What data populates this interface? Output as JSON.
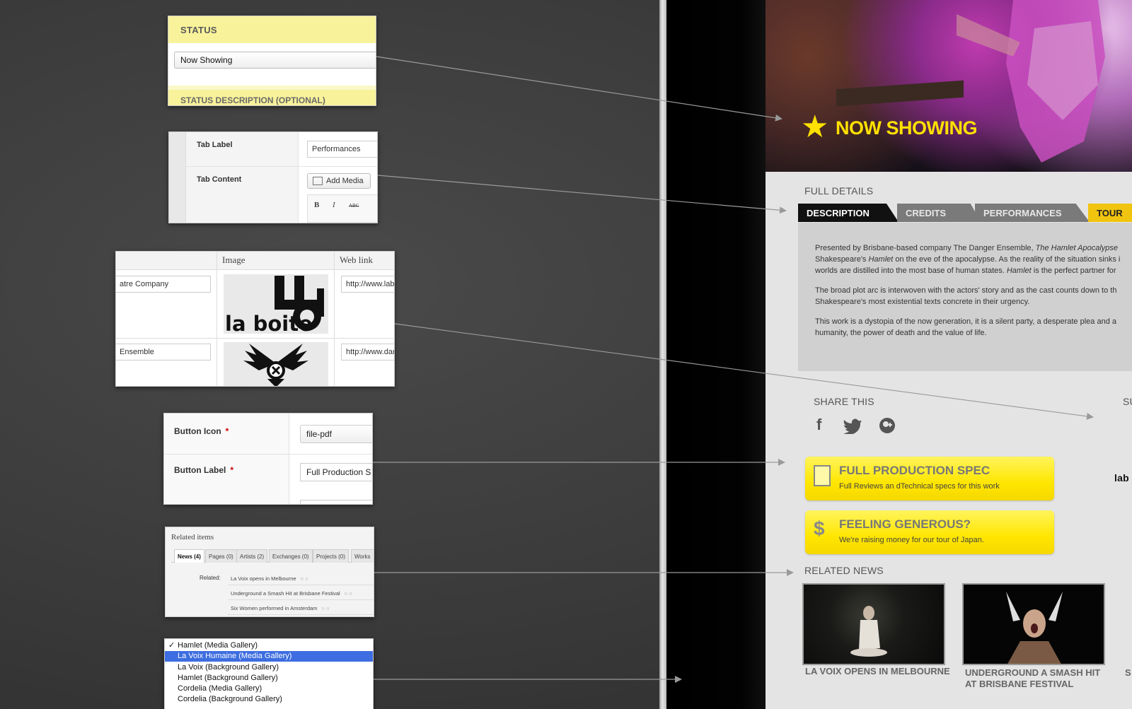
{
  "status_snippet": {
    "heading": "STATUS",
    "value": "Now Showing",
    "heading2": "STATUS DESCRIPTION (OPTIONAL)"
  },
  "tab_snippet": {
    "tab_label_label": "Tab Label",
    "tab_label_value": "Performances",
    "tab_content_label": "Tab Content",
    "add_media_label": "Add Media",
    "editor_bold": "B",
    "editor_italic": "I",
    "editor_strike": "ABC"
  },
  "logos_snippet": {
    "col_image": "Image",
    "col_weblink": "Web link",
    "rows": [
      {
        "name": "atre Company",
        "logo_text": "la boite",
        "link": "http://www.labo"
      },
      {
        "name": "Ensemble",
        "link": "http://www.dan"
      }
    ]
  },
  "button_snippet": {
    "icon_label": "Button Icon",
    "icon_value": "file-pdf",
    "label_label": "Button Label",
    "label_value": "Full Production S",
    "required": "*"
  },
  "related_snippet": {
    "title": "Related items",
    "tabs": [
      "News (4)",
      "Pages (0)",
      "Artists (2)",
      "Exchanges (0)",
      "Projects (0)",
      "Works"
    ],
    "related_label": "Related:",
    "items": [
      "La Voix opens in Melbourne",
      "Underground a Smash Hit at Brisbane Festival",
      "Six Women performed in Amsterdam"
    ]
  },
  "list_snippet": {
    "checkmark": "✓",
    "items": [
      "Hamlet (Media Gallery)",
      "La Voix Humaine (Media Gallery)",
      "La Voix (Background Gallery)",
      "Hamlet (Background Gallery)",
      "Cordelia (Media Gallery)",
      "Cordelia (Background Gallery)"
    ],
    "selected_index": 1
  },
  "page": {
    "hero_status": "NOW SHOWING",
    "full_details_title": "FULL DETAILS",
    "tabs": [
      "DESCRIPTION",
      "CREDITS",
      "PERFORMANCES",
      "TOUR"
    ],
    "description": {
      "p1_a": "Presented by Brisbane-based company The Danger Ensemble, ",
      "p1_em": "The Hamlet Apocalypse",
      "p1_b": "Shakespeare's ",
      "p1_em2": "Hamlet",
      "p1_c": " on the eve of the apocalypse. As the reality of the situation sinks i",
      "p1_d": "worlds are distilled into the most base of human states. ",
      "p1_em3": "Hamlet",
      "p1_e": " is the perfect partner for",
      "p2_a": "The broad plot arc is interwoven with the actors' story and as the cast counts down to th",
      "p2_b": "Shakespeare's most existential texts concrete in their urgency.",
      "p3_a": "This work is a dystopia of the now generation, it is a silent party, a desperate plea and a",
      "p3_b": "humanity, the power of death and the value of life."
    },
    "share_title": "SHARE THIS",
    "share_icons": [
      "facebook-icon",
      "twitter-icon",
      "google-plus-icon"
    ],
    "support_fragment": "SU",
    "spec_button": {
      "title": "FULL PRODUCTION SPEC",
      "subtitle": "Full Reviews an dTechnical specs for this work"
    },
    "donate_button": {
      "title": "FEELING GENEROUS?",
      "subtitle": "We're raising money for our tour of Japan.",
      "icon": "$"
    },
    "sponsor_fragment": "lab",
    "related_news_title": "RELATED NEWS",
    "news": [
      "LA VOIX OPENS IN MELBOURNE",
      "UNDERGROUND A SMASH HIT AT BRISBANE FESTIVAL"
    ],
    "news_fragment": "S"
  },
  "colors": {
    "accent_yellow": "#ffe000",
    "tab_active": "#111111",
    "tab_inactive": "#7a7a7a",
    "tab_tour": "#f1c40f",
    "list_selection": "#3d6de0"
  }
}
